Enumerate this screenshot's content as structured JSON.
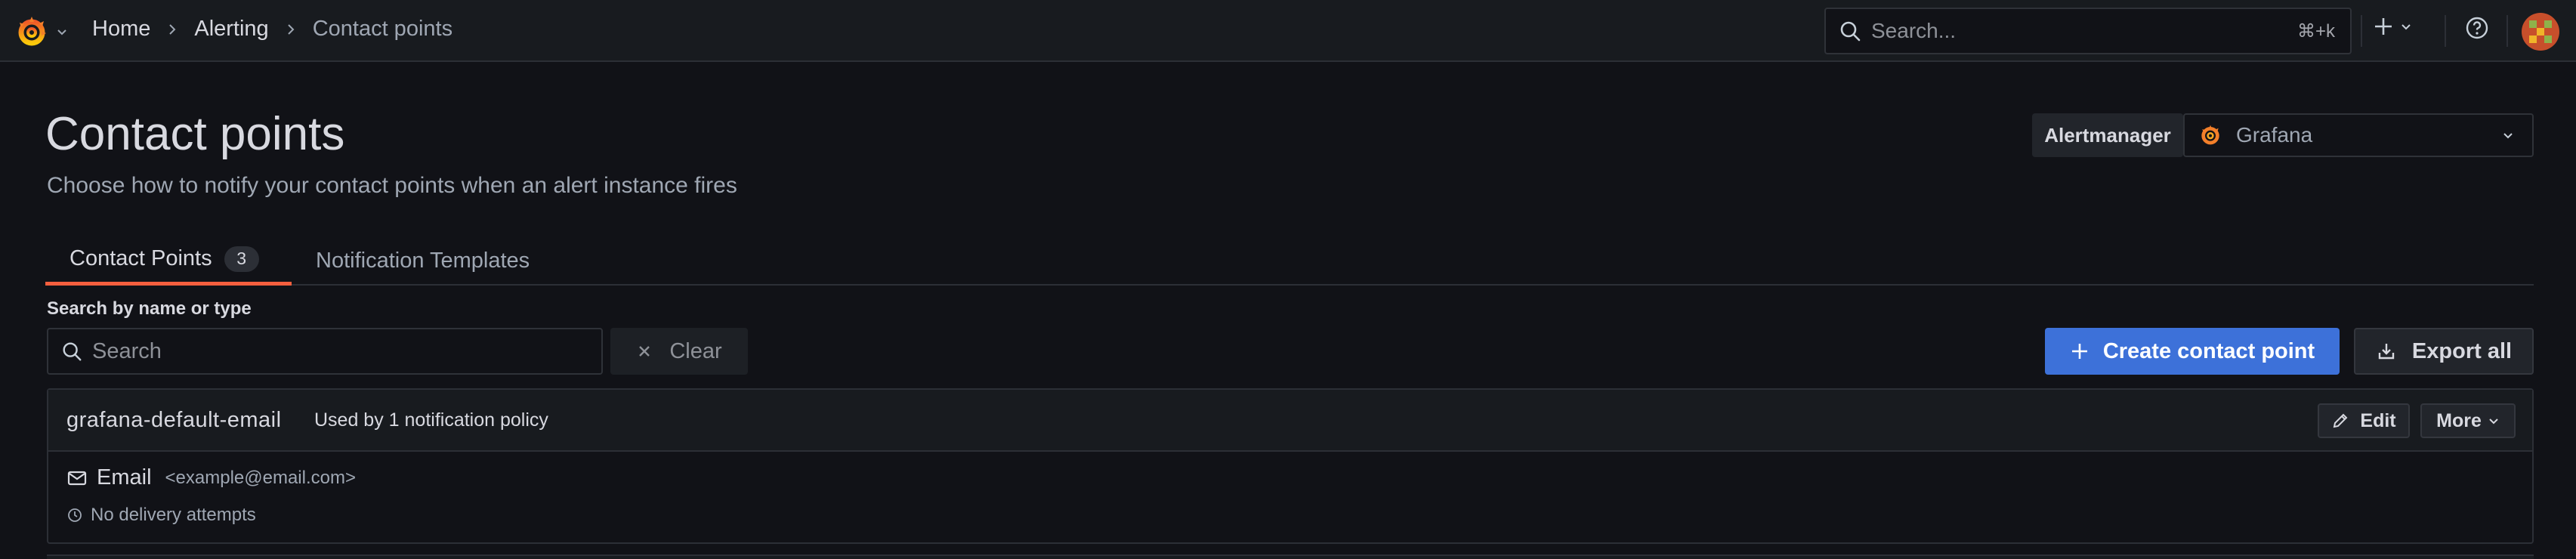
{
  "colors": {
    "accent": "#f55f3e",
    "primary": "#3d71d9",
    "background": "#111217"
  },
  "topbar": {
    "breadcrumbs": [
      "Home",
      "Alerting",
      "Contact points"
    ],
    "search_placeholder": "Search...",
    "search_shortcut": "⌘+k"
  },
  "header": {
    "title": "Contact points",
    "subtitle": "Choose how to notify your contact points when an alert instance fires",
    "alertmanager_label": "Alertmanager",
    "alertmanager_value": "Grafana"
  },
  "tabs": [
    {
      "label": "Contact Points",
      "count": "3",
      "active": true
    },
    {
      "label": "Notification Templates",
      "active": false
    }
  ],
  "filter": {
    "label": "Search by name or type",
    "placeholder": "Search",
    "clear_label": "Clear"
  },
  "actions": {
    "create_label": "Create contact point",
    "export_label": "Export all"
  },
  "contact_points": [
    {
      "name": "grafana-default-email",
      "usage": "Used by 1 notification policy",
      "edit_label": "Edit",
      "more_label": "More",
      "integration_type": "Email",
      "integration_address": "<example@email.com>",
      "delivery_status": "No delivery attempts"
    }
  ]
}
